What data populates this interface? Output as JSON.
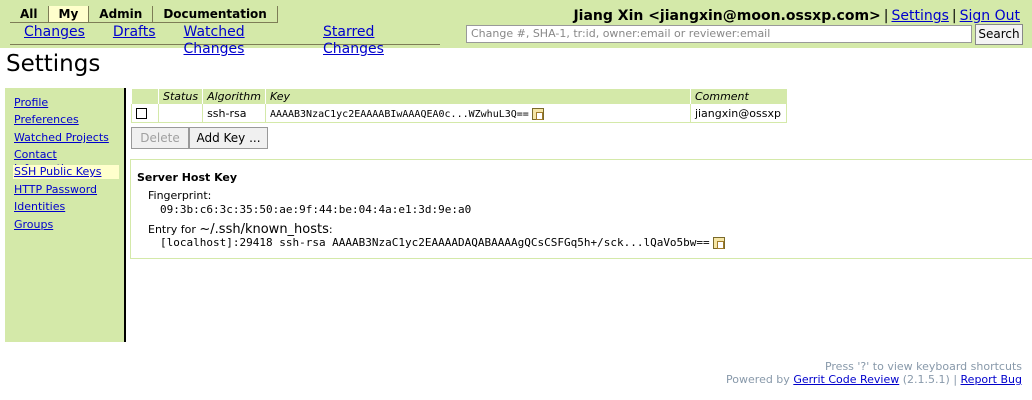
{
  "header": {
    "top_menu": [
      {
        "label": "All"
      },
      {
        "label": "My"
      },
      {
        "label": "Admin"
      },
      {
        "label": "Documentation"
      }
    ],
    "sub_menu": [
      {
        "label": "Changes"
      },
      {
        "label": "Drafts"
      },
      {
        "label": "Watched Changes"
      },
      {
        "label": "Starred Changes"
      }
    ],
    "user": "Jiang Xin <jiangxin@moon.ossxp.com>",
    "settings_link": "Settings",
    "sign_out_link": "Sign Out",
    "search_placeholder": "Change #, SHA-1, tr:id, owner:email or reviewer:email",
    "search_button": "Search"
  },
  "page_title": "Settings",
  "sidebar": {
    "items": [
      {
        "label": "Profile"
      },
      {
        "label": "Preferences"
      },
      {
        "label": "Watched Projects"
      },
      {
        "label": "Contact Information"
      },
      {
        "label": "SSH Public Keys"
      },
      {
        "label": "HTTP Password"
      },
      {
        "label": "Identities"
      },
      {
        "label": "Groups"
      }
    ],
    "selected": "SSH Public Keys"
  },
  "keys_table": {
    "headers": {
      "status": "Status",
      "algorithm": "Algorithm",
      "key": "Key",
      "comment": "Comment"
    },
    "rows": [
      {
        "status": "",
        "algorithm": "ssh-rsa",
        "key": "AAAAB3NzaC1yc2EAAAABIwAAAQEA0c...WZwhuL3Q==",
        "comment": "jiangxin@ossxp"
      }
    ]
  },
  "buttons": {
    "delete": "Delete",
    "add_key": "Add Key ..."
  },
  "server_host_key": {
    "heading": "Server Host Key",
    "fingerprint_label": "Fingerprint:",
    "fingerprint": "09:3b:c6:3c:35:50:ae:9f:44:be:04:4a:e1:3d:9e:a0",
    "entry_label_prefix": "Entry for ",
    "entry_label_path": "~/.ssh/known_hosts",
    "entry_label_suffix": ":",
    "entry": "[localhost]:29418 ssh-rsa AAAAB3NzaC1yc2EAAAADAQABAAAAgQCsCSFGq5h+/sck...lQaVo5bw=="
  },
  "footer": {
    "shortcuts": "Press '?' to view keyboard shortcuts",
    "powered_by": "Powered by",
    "gerrit_link": "Gerrit Code Review",
    "version": "(2.1.5.1)",
    "separator": "|",
    "report_bug": "Report Bug"
  },
  "colors": {
    "accent_green": "#d4e9a9",
    "selected_yellow": "#ffffcc",
    "link_blue": "#0000cc"
  }
}
